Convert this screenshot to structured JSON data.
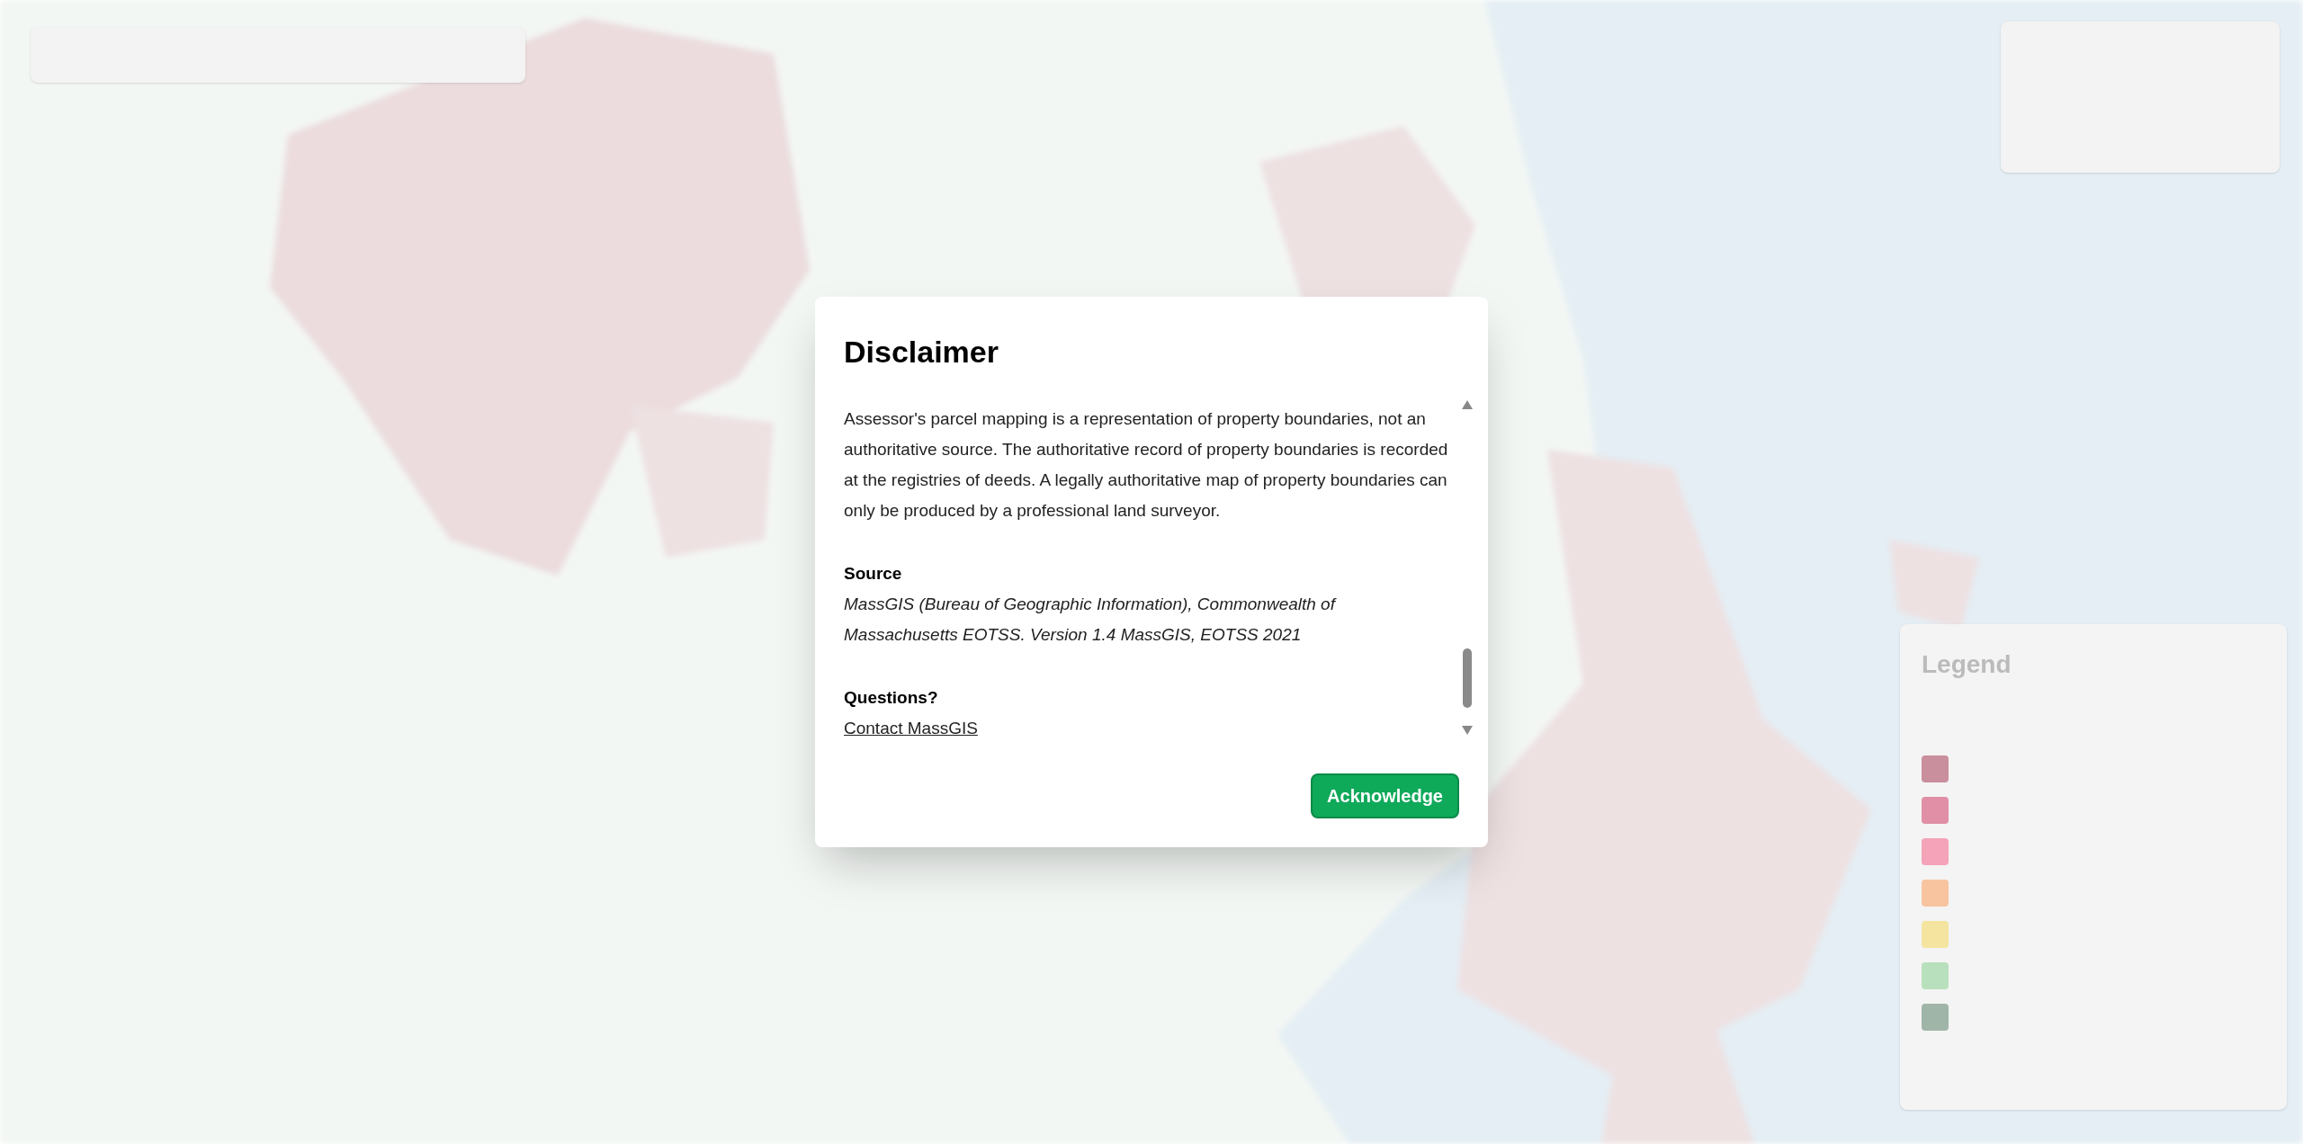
{
  "legend": {
    "title": "Legend",
    "swatches": [
      {
        "color": "#c98f9c"
      },
      {
        "color": "#e08fa6"
      },
      {
        "color": "#f4a3b8"
      },
      {
        "color": "#f8c4a0"
      },
      {
        "color": "#f4e4a0"
      },
      {
        "color": "#b8e0bc"
      },
      {
        "color": "#9fb5a8"
      }
    ]
  },
  "dialog": {
    "title": "Disclaimer",
    "paragraph": "Assessor's parcel mapping is a representation of property boundaries, not an authoritative source. The authoritative record of property boundaries is recorded at the registries of deeds. A legally authoritative map of property boundaries can only be produced by a professional land surveyor.",
    "sections": [
      {
        "heading": "Source",
        "kind": "text",
        "body": "MassGIS (Bureau of Geographic Information), Commonwealth of Massachusetts EOTSS. Version 1.4 MassGIS, EOTSS 2021"
      },
      {
        "heading": "Questions?",
        "kind": "link",
        "body": "Contact MassGIS"
      }
    ],
    "button": "Acknowledge"
  }
}
